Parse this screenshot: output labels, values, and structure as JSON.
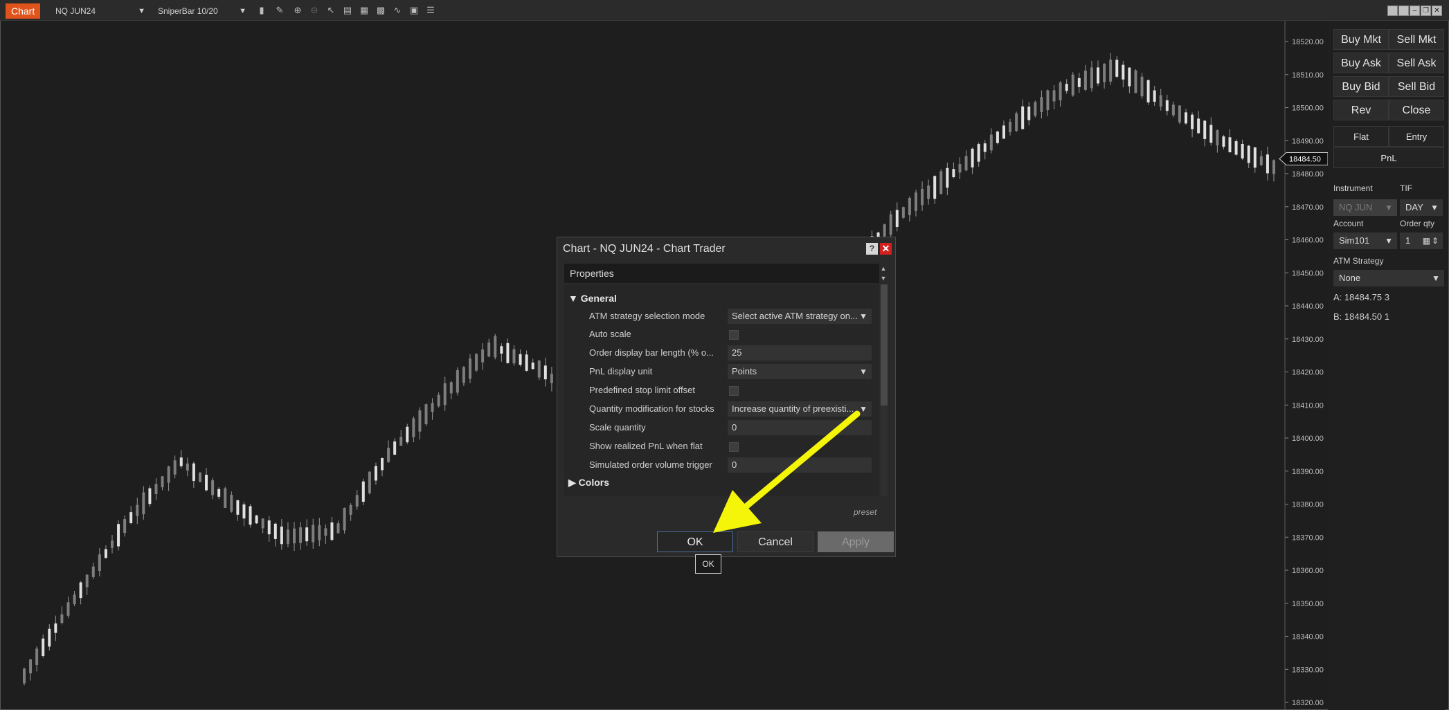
{
  "toolbar": {
    "tab_label": "Chart",
    "instrument": "NQ JUN24",
    "bar_type": "SniperBar 10/20",
    "icons": [
      "bar-type-icon",
      "draw-icon",
      "zoom-in-icon",
      "zoom-out-icon",
      "pointer-icon",
      "properties-icon",
      "data-box-icon",
      "strategies-icon",
      "indicators-icon",
      "templates-icon",
      "chart-trader-icon"
    ],
    "window_controls": [
      "link-icon",
      "pin-icon",
      "minimize-icon",
      "restore-icon",
      "close-icon"
    ]
  },
  "price_axis": {
    "ticks": [
      "18520.00",
      "18510.00",
      "18500.00",
      "18490.00",
      "18480.00",
      "18470.00",
      "18460.00",
      "18450.00",
      "18440.00",
      "18430.00",
      "18420.00",
      "18410.00",
      "18400.00",
      "18390.00",
      "18380.00",
      "18370.00",
      "18360.00",
      "18350.00",
      "18340.00",
      "18330.00",
      "18320.00"
    ],
    "current_price": "18484.50"
  },
  "chart_trader": {
    "buttons": [
      [
        "Buy Mkt",
        "Sell Mkt"
      ],
      [
        "Buy Ask",
        "Sell Ask"
      ],
      [
        "Buy Bid",
        "Sell Bid"
      ],
      [
        "Rev",
        "Close"
      ]
    ],
    "position": {
      "flat": "Flat",
      "entry": "Entry",
      "pnl": "PnL"
    },
    "instrument_label": "Instrument",
    "tif_label": "TIF",
    "instrument_value": "NQ JUN",
    "tif_value": "DAY",
    "account_label": "Account",
    "order_qty_label": "Order qty",
    "account_value": "Sim101",
    "order_qty_value": "1",
    "atm_label": "ATM Strategy",
    "atm_value": "None",
    "ask_line": "A: 18484.75  3",
    "bid_line": "B: 18484.50  1"
  },
  "dialog": {
    "title": "Chart - NQ JUN24 - Chart Trader",
    "help": "?",
    "close": "✕",
    "properties_label": "Properties",
    "general_label": "General",
    "colors_label": "Colors",
    "rows": [
      {
        "label": "ATM strategy selection mode",
        "value": "Select active ATM strategy on...",
        "kind": "select"
      },
      {
        "label": "Auto scale",
        "value": "",
        "kind": "checkbox"
      },
      {
        "label": "Order display bar length (% o...",
        "value": "25",
        "kind": "text"
      },
      {
        "label": "PnL display unit",
        "value": "Points",
        "kind": "select"
      },
      {
        "label": "Predefined stop limit offset",
        "value": "",
        "kind": "checkbox"
      },
      {
        "label": "Quantity modification for stocks",
        "value": "Increase quantity of preexisti...",
        "kind": "select"
      },
      {
        "label": "Scale quantity",
        "value": "0",
        "kind": "text"
      },
      {
        "label": "Show realized PnL when flat",
        "value": "",
        "kind": "checkbox"
      },
      {
        "label": "Simulated order volume trigger",
        "value": "0",
        "kind": "text"
      }
    ],
    "preset_label": "preset",
    "ok_label": "OK",
    "cancel_label": "Cancel",
    "apply_label": "Apply",
    "tooltip": "OK"
  },
  "colors": {
    "background": "#1e1e1e",
    "accent_tab": "#e0541c",
    "arrow": "#f5f50a",
    "candle": "#c8c8c8"
  },
  "chart_data": {
    "type": "candlestick",
    "y_axis_range": [
      18320,
      18525
    ],
    "trend": [
      18328,
      18352,
      18375,
      18393,
      18380,
      18370,
      18372,
      18395,
      18412,
      18428,
      18420,
      18405,
      18415,
      18430,
      18442,
      18438,
      18455,
      18470,
      18482,
      18495,
      18506,
      18512,
      18500,
      18490,
      18482
    ]
  }
}
